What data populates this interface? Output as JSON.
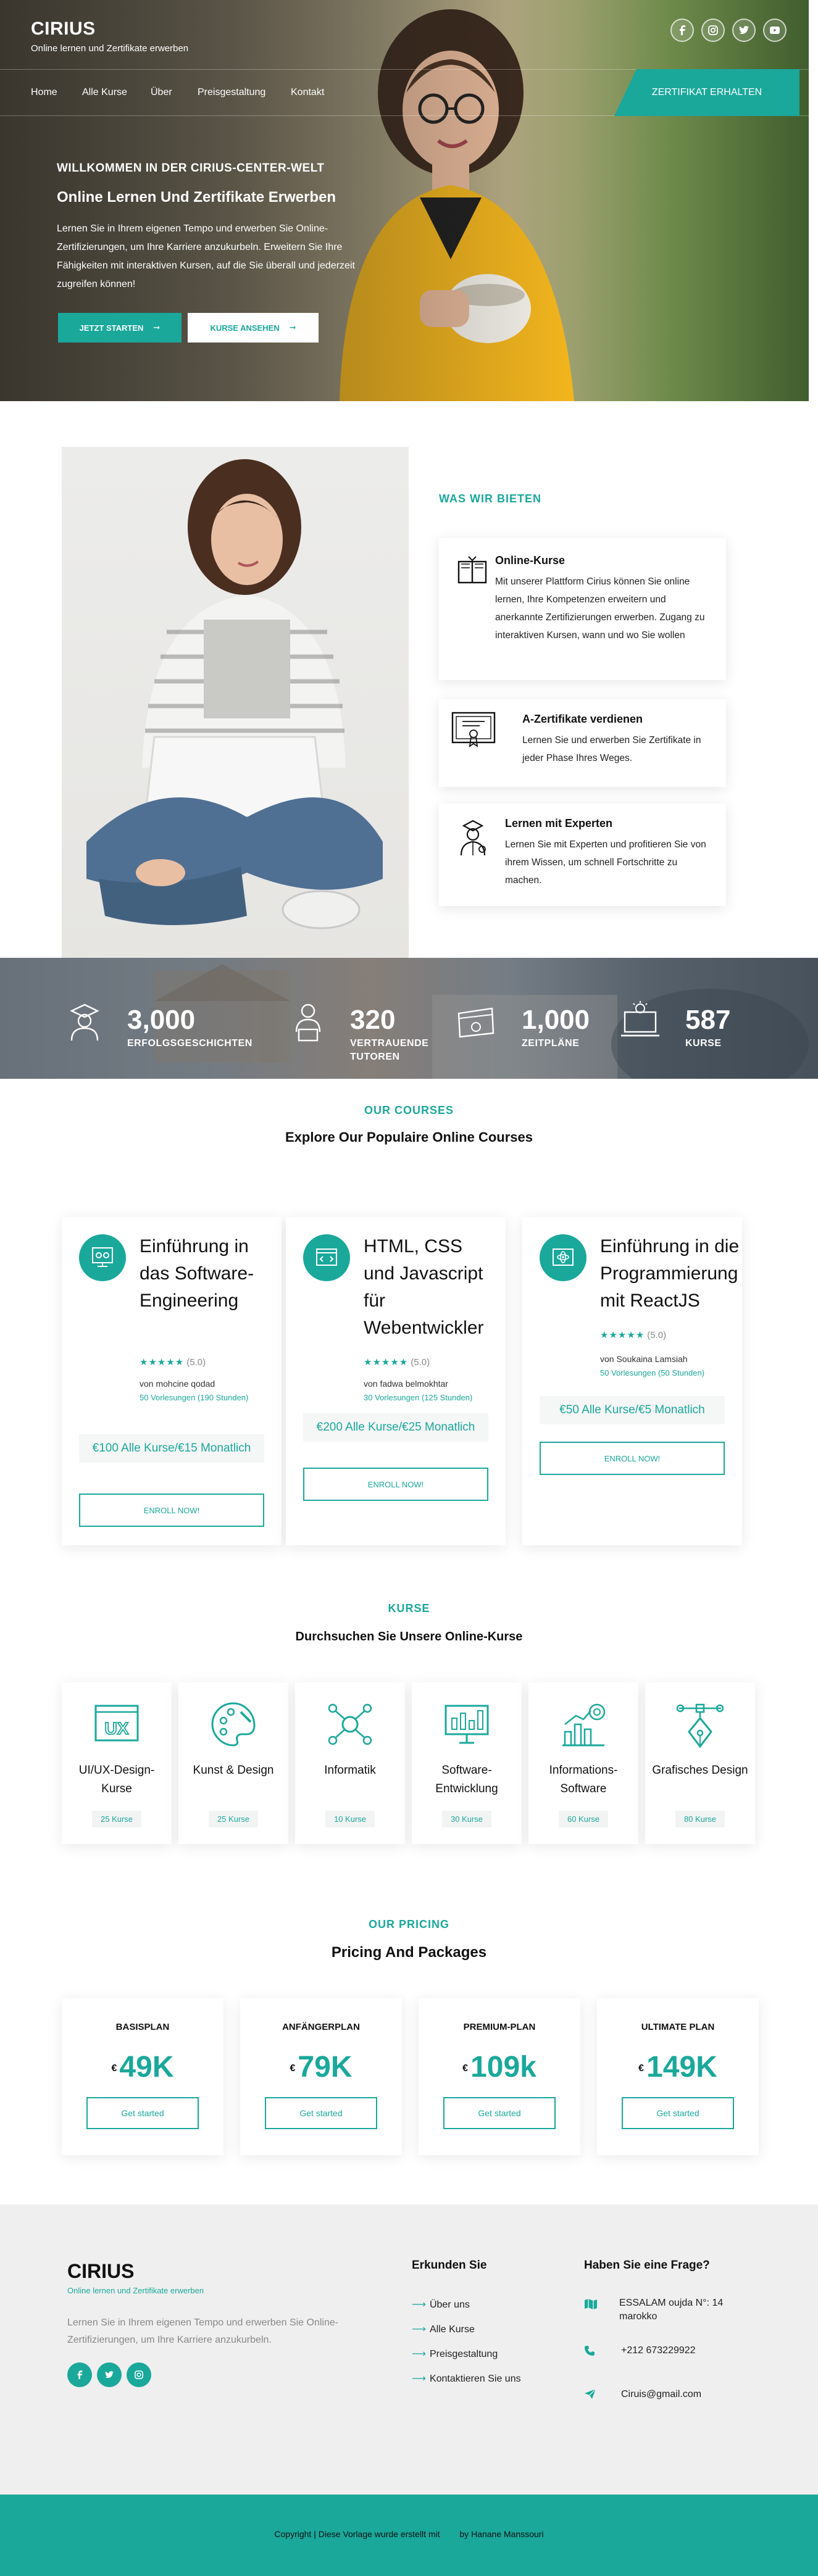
{
  "brand": {
    "name": "CIRIUS",
    "tagline": "Online lernen und Zertifikate erwerben"
  },
  "colors": {
    "accent": "#1aa89b",
    "footer_bg": "#efefef"
  },
  "social": [
    {
      "name": "facebook-icon"
    },
    {
      "name": "instagram-icon"
    },
    {
      "name": "twitter-icon"
    },
    {
      "name": "youtube-icon"
    }
  ],
  "nav": {
    "items": [
      "Home",
      "Alle Kurse",
      "Über",
      "Preisgestaltung",
      "Kontakt"
    ],
    "cta": "ZERTIFIKAT ERHALTEN"
  },
  "hero": {
    "kicker": "WILLKOMMEN IN DER CIRIUS-CENTER-WELT",
    "title": "Online Lernen Und Zertifikate Erwerben",
    "text": "Lernen Sie in Ihrem eigenen Tempo und erwerben Sie Online-Zertifizierungen, um Ihre Karriere anzukurbeln. Erweitern Sie Ihre Fähigkeiten mit interaktiven Kursen, auf die Sie überall und jederzeit zugreifen können!",
    "btn_start": "JETZT STARTEN",
    "btn_courses": "KURSE ANSEHEN"
  },
  "offer": {
    "kicker": "WAS WIR BIETEN",
    "cards": [
      {
        "icon": "book-icon",
        "title": "Online-Kurse",
        "text": "Mit unserer Plattform Cirius können Sie online lernen, Ihre Kompetenzen erweitern und anerkannte Zertifizierungen erwerben. Zugang zu interaktiven Kursen, wann und wo Sie wollen"
      },
      {
        "icon": "certificate-icon",
        "title": "A-Zertifikate verdienen",
        "text": "Lernen Sie und erwerben Sie Zertifikate in jeder Phase Ihres Weges."
      },
      {
        "icon": "expert-icon",
        "title": "Lernen mit Experten",
        "text": "Lernen Sie mit Experten und profitieren Sie von ihrem Wissen, um schnell Fortschritte zu machen."
      }
    ]
  },
  "stats": [
    {
      "icon": "graduate-icon",
      "value": "3,000",
      "label": "ERFOLGSGESCHICHTEN"
    },
    {
      "icon": "tutor-icon",
      "value": "320",
      "label": "VERTRAUENDE TUTOREN"
    },
    {
      "icon": "calendar-icon",
      "value": "1,000",
      "label": "ZEITPLÄNE"
    },
    {
      "icon": "laptop-icon",
      "value": "587",
      "label": "KURSE"
    }
  ],
  "courses": {
    "kicker": "OUR COURSES",
    "title": "Explore Our Populaire Online Courses",
    "items": [
      {
        "icon": "software-icon",
        "title": "Einführung in das Software-Engineering",
        "stars": "★★★★★",
        "rating": "(5.0)",
        "by": "von mohcine qodad",
        "lessons": "50 Vorlesungen (190 Stunden)",
        "price": "€100 Alle Kurse/€15 Monatlich",
        "enroll": "ENROLL NOW!"
      },
      {
        "icon": "html-icon",
        "title": "HTML, CSS und Javascript für Webentwickler",
        "stars": "★★★★★",
        "rating": "(5.0)",
        "by": "von fadwa belmokhtar",
        "lessons": "30 Vorlesungen (125 Stunden)",
        "price": "€200 Alle Kurse/€25 Monatlich",
        "enroll": "ENROLL NOW!"
      },
      {
        "icon": "react-icon",
        "title": "Einführung in die Programmierung mit ReactJS",
        "stars": "★★★★★",
        "rating": "(5.0)",
        "by": "von Soukaina Lamsiah",
        "lessons": "50 Vorlesungen (50 Stunden)",
        "price": "€50 Alle Kurse/€5 Monatlich",
        "enroll": "ENROLL NOW!"
      }
    ]
  },
  "categories": {
    "kicker": "KURSE",
    "title": "Durchsuchen Sie Unsere Online-Kurse",
    "items": [
      {
        "icon": "ux-icon",
        "name": "UI/UX-Design-Kurse",
        "count": "25 Kurse"
      },
      {
        "icon": "palette-icon",
        "name": "Kunst & Design",
        "count": "25 Kurse"
      },
      {
        "icon": "network-icon",
        "name": "Informatik",
        "count": "10 Kurse"
      },
      {
        "icon": "monitor-icon",
        "name": "Software-Entwicklung",
        "count": "30 Kurse"
      },
      {
        "icon": "chart-icon",
        "name": "Informations-Software",
        "count": "60 Kurse"
      },
      {
        "icon": "pen-icon",
        "name": "Grafisches Design",
        "count": "80 Kurse"
      }
    ]
  },
  "pricing": {
    "kicker": "OUR PRICING",
    "title": "Pricing And Packages",
    "currency": "€",
    "plans": [
      {
        "name": "BASISPLAN",
        "price": "49K",
        "btn": "Get started"
      },
      {
        "name": "ANFÄNGERPLAN",
        "price": "79K",
        "btn": "Get started"
      },
      {
        "name": "PREMIUM-PLAN",
        "price": "109k",
        "btn": "Get started"
      },
      {
        "name": "ULTIMATE PLAN",
        "price": "149K",
        "btn": "Get started"
      }
    ]
  },
  "footer": {
    "brand": "CIRIUS",
    "tagline": "Online lernen und Zertifikate erwerben",
    "about": "Lernen Sie in Ihrem eigenen Tempo und erwerben Sie Online-Zertifizierungen, um Ihre Karriere anzukurbeln.",
    "explore_title": "Erkunden Sie",
    "explore_links": [
      "Über uns",
      "Alle Kurse",
      "Preisgestaltung",
      "Kontaktieren Sie uns"
    ],
    "contact_title": "Haben Sie eine Frage?",
    "address": "ESSALAM oujda N°: 14 marokko",
    "phone": "+212 673229922",
    "email": "Ciruis@gmail.com",
    "copyright": "Copyright | Diese Vorlage wurde erstellt mit",
    "author": "by Hanane Manssouri"
  }
}
